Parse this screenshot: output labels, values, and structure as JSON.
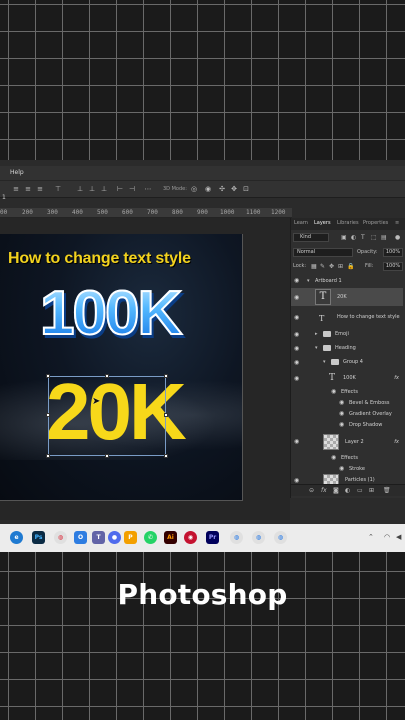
{
  "menubar": {
    "partial_item": "",
    "help": "Help"
  },
  "left_marker": "1",
  "options_bar": {
    "mode_label": "3D Mode:"
  },
  "ruler": {
    "ticks": [
      "200",
      "300",
      "400",
      "500",
      "600",
      "700",
      "800",
      "900",
      "1000",
      "1100",
      "1200"
    ],
    "first": "00"
  },
  "artboard": {
    "title": "How to change text style",
    "big_text_1": "100K",
    "big_text_2": "20K"
  },
  "layers_panel": {
    "tabs": [
      "Learn",
      "Layers",
      "Libraries",
      "Properties"
    ],
    "active_tab": "Layers",
    "kind_label": "Kind",
    "blend_mode": "Normal",
    "opacity_label": "Opacity:",
    "opacity_value": "100%",
    "lock_label": "Lock:",
    "fill_label": "Fill:",
    "fill_value": "100%",
    "layers": [
      {
        "name": "Artboard 1",
        "type": "artboard"
      },
      {
        "name": "20K",
        "type": "text",
        "selected": true
      },
      {
        "name": "How to change text style",
        "type": "text"
      },
      {
        "name": "Emoji",
        "type": "group"
      },
      {
        "name": "Heading",
        "type": "group"
      },
      {
        "name": "Group 4",
        "type": "group"
      },
      {
        "name": "100K",
        "type": "text",
        "fx": "fx"
      },
      {
        "name": "Effects",
        "type": "effects"
      },
      {
        "name": "Bevel & Emboss",
        "type": "effect"
      },
      {
        "name": "Gradient Overlay",
        "type": "effect"
      },
      {
        "name": "Drop Shadow",
        "type": "effect"
      },
      {
        "name": "Layer 2",
        "type": "image",
        "fx": "fx"
      },
      {
        "name": "Effects",
        "type": "effects"
      },
      {
        "name": "Stroke",
        "type": "effect"
      },
      {
        "name": "Particles (1)",
        "type": "image"
      }
    ]
  },
  "caption": "Photoshop",
  "colors": {
    "accent_yellow": "#f7d81a",
    "accent_blue": "#3fb1ff",
    "panel_bg": "#2f2f2f",
    "taskbar_bg": "#ececec"
  }
}
